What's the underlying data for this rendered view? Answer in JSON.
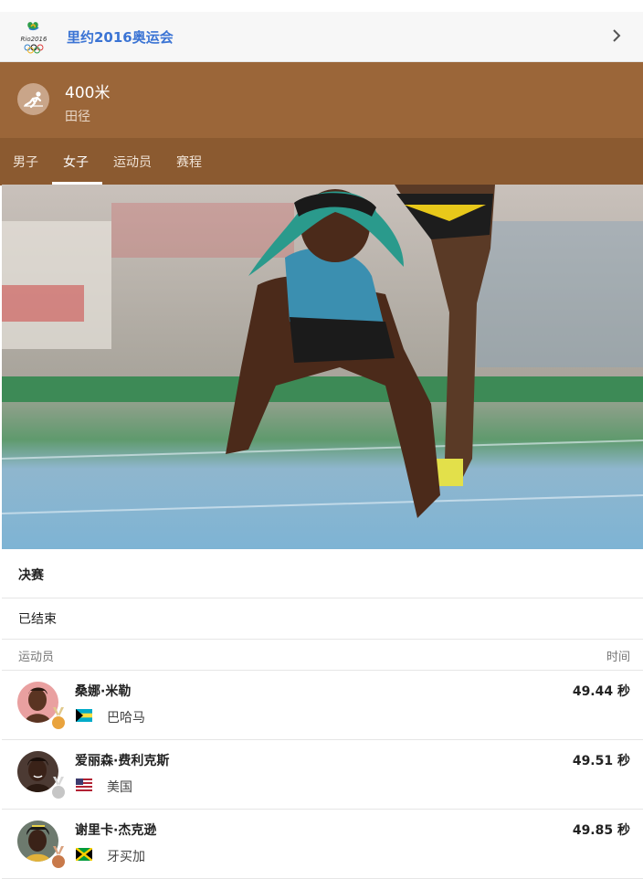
{
  "header": {
    "title": "里约2016奥运会"
  },
  "event": {
    "name": "400米",
    "sport": "田径"
  },
  "tabs": [
    {
      "label": "男子"
    },
    {
      "label": "女子",
      "active": true
    },
    {
      "label": "运动员"
    },
    {
      "label": "赛程"
    }
  ],
  "section": {
    "title": "决赛",
    "status": "已结束"
  },
  "columns": {
    "athlete": "运动员",
    "time": "时间"
  },
  "results": [
    {
      "name": "桑娜·米勒",
      "country": "巴哈马",
      "time": "49.44 秒",
      "medal": "gold"
    },
    {
      "name": "爱丽森·费利克斯",
      "country": "美国",
      "time": "49.51 秒",
      "medal": "silver"
    },
    {
      "name": "谢里卡·杰克逊",
      "country": "牙买加",
      "time": "49.85 秒",
      "medal": "bronze"
    }
  ],
  "colors": {
    "header_link": "#3b74d4",
    "event_bg": "#9b6639",
    "tabs_bg": "#8b5a30",
    "gold": "#e9a33d",
    "silver": "#c6c6c6",
    "bronze": "#c8794a"
  }
}
